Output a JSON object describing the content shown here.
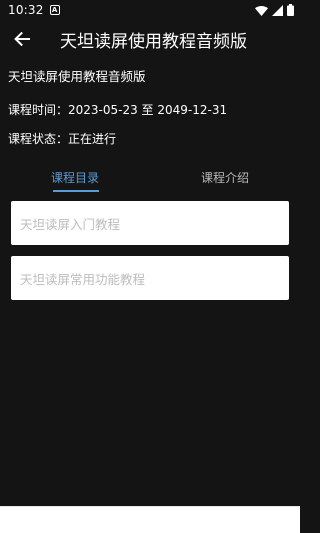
{
  "status_bar": {
    "time": "10:32",
    "notification_glyph": "A",
    "icons": [
      "wifi-icon",
      "signal-icon",
      "battery-icon"
    ]
  },
  "app_bar": {
    "back_icon": "arrow-left-icon",
    "title": "天坦读屏使用教程音频版"
  },
  "course": {
    "name": "天坦读屏使用教程音频版",
    "time_text": "课程时间：2023-05-23 至 2049-12-31",
    "status_text": "课程状态：正在进行"
  },
  "tabs": [
    {
      "label": "课程目录",
      "active": true
    },
    {
      "label": "课程介绍",
      "active": false
    }
  ],
  "lessons": [
    {
      "title": "天坦读屏入门教程"
    },
    {
      "title": "天坦读屏常用功能教程"
    }
  ],
  "colors": {
    "background": "#141414",
    "accent": "#5b9bd5",
    "card": "#ffffff",
    "card_text": "#bdbdbd",
    "inactive_tab": "#b8b8b8"
  }
}
